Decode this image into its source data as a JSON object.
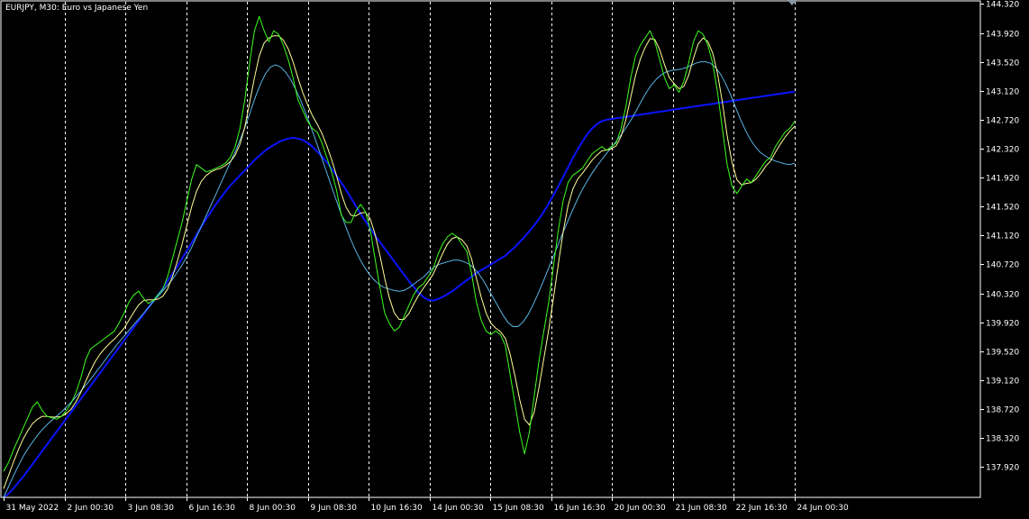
{
  "chart_title": "EURJPY, M30:  Euro vs Japanese Yen",
  "colors": {
    "background": "#000000",
    "frame": "#ffffff",
    "price": "#3cff1e",
    "ma_fast": "#ffff99",
    "ma_mid": "#5ab4e6",
    "ma_slow": "#0a14ff",
    "grid": "#ffffff"
  },
  "chart_data": {
    "type": "line",
    "title": "EURJPY, M30:  Euro vs Japanese Yen",
    "x_labels": [
      "31 May 2022",
      "2 Jun 00:30",
      "3 Jun 08:30",
      "6 Jun 16:30",
      "8 Jun 00:30",
      "9 Jun 08:30",
      "10 Jun 16:30",
      "14 Jun 00:30",
      "15 Jun 08:30",
      "16 Jun 16:30",
      "20 Jun 00:30",
      "21 Jun 08:30",
      "22 Jun 16:30",
      "24 Jun 00:30"
    ],
    "y_ticks": [
      "144.320",
      "143.920",
      "143.520",
      "143.120",
      "142.720",
      "142.320",
      "141.920",
      "141.520",
      "141.120",
      "140.720",
      "140.320",
      "139.920",
      "139.520",
      "139.120",
      "138.720",
      "138.320",
      "137.920"
    ],
    "ylim": [
      137.5,
      144.35
    ],
    "x_count": 14,
    "grid": "vertical dashed",
    "series": [
      {
        "key": "price",
        "color": "#3cff1e",
        "width": 1,
        "values": [
          137.86,
          137.98,
          138.15,
          138.3,
          138.45,
          138.6,
          138.75,
          138.82,
          138.7,
          138.62,
          138.6,
          138.58,
          138.62,
          138.7,
          138.8,
          138.95,
          139.15,
          139.4,
          139.55,
          139.6,
          139.65,
          139.7,
          139.75,
          139.8,
          139.92,
          140.05,
          140.2,
          140.3,
          140.35,
          140.25,
          140.18,
          140.22,
          140.3,
          140.38,
          140.55,
          140.8,
          141.05,
          141.3,
          141.6,
          141.9,
          142.1,
          142.05,
          142.0,
          142.02,
          142.05,
          142.08,
          142.12,
          142.2,
          142.35,
          142.6,
          143.0,
          143.5,
          143.95,
          144.15,
          143.95,
          143.8,
          143.95,
          143.9,
          143.75,
          143.55,
          143.3,
          143.0,
          142.85,
          142.7,
          142.6,
          142.55,
          142.4,
          142.2,
          142.0,
          141.75,
          141.4,
          141.3,
          141.3,
          141.45,
          141.55,
          141.45,
          141.2,
          140.8,
          140.4,
          140.05,
          139.9,
          139.8,
          139.85,
          140.0,
          140.15,
          140.3,
          140.4,
          140.45,
          140.55,
          140.65,
          140.85,
          141.0,
          141.1,
          141.15,
          141.1,
          141.0,
          140.9,
          140.6,
          140.2,
          139.95,
          139.8,
          139.75,
          139.8,
          139.75,
          139.6,
          139.2,
          138.8,
          138.4,
          138.1,
          138.4,
          138.9,
          139.4,
          139.8,
          140.2,
          140.7,
          141.2,
          141.6,
          141.85,
          141.95,
          142.0,
          142.05,
          142.15,
          142.25,
          142.3,
          142.35,
          142.3,
          142.35,
          142.4,
          142.6,
          142.9,
          143.3,
          143.6,
          143.75,
          143.85,
          143.95,
          143.8,
          143.55,
          143.3,
          143.15,
          143.2,
          143.1,
          143.25,
          143.5,
          143.8,
          143.95,
          143.9,
          143.75,
          143.5,
          143.1,
          142.6,
          142.1,
          141.8,
          141.7,
          141.8,
          141.9,
          141.85,
          141.95,
          142.05,
          142.15,
          142.2,
          142.35,
          142.45,
          142.55,
          142.6,
          142.7
        ]
      },
      {
        "key": "ma_fast",
        "color": "#ffff99",
        "width": 1,
        "values": [
          137.62,
          137.8,
          137.98,
          138.15,
          138.3,
          138.42,
          138.52,
          138.58,
          138.62,
          138.62,
          138.61,
          138.61,
          138.62,
          138.66,
          138.72,
          138.82,
          138.95,
          139.1,
          139.25,
          139.38,
          139.48,
          139.56,
          139.63,
          139.69,
          139.76,
          139.84,
          139.95,
          140.06,
          140.16,
          140.22,
          140.23,
          140.23,
          140.24,
          140.28,
          140.38,
          140.55,
          140.76,
          141.0,
          141.26,
          141.52,
          141.73,
          141.87,
          141.95,
          142.0,
          142.03,
          142.05,
          142.09,
          142.14,
          142.23,
          142.38,
          142.62,
          142.95,
          143.3,
          143.6,
          143.78,
          143.85,
          143.88,
          143.88,
          143.82,
          143.7,
          143.52,
          143.3,
          143.1,
          142.93,
          142.78,
          142.66,
          142.53,
          142.36,
          142.17,
          141.95,
          141.7,
          141.51,
          141.4,
          141.39,
          141.43,
          141.44,
          141.35,
          141.14,
          140.85,
          140.53,
          140.25,
          140.05,
          139.96,
          139.96,
          140.04,
          140.17,
          140.29,
          140.39,
          140.48,
          140.58,
          140.72,
          140.87,
          141.0,
          141.08,
          141.1,
          141.06,
          140.98,
          140.8,
          140.53,
          140.27,
          140.05,
          139.91,
          139.84,
          139.79,
          139.7,
          139.48,
          139.18,
          138.85,
          138.58,
          138.5,
          138.68,
          139.03,
          139.42,
          139.82,
          140.26,
          140.73,
          141.17,
          141.53,
          141.76,
          141.9,
          141.98,
          142.07,
          142.16,
          142.23,
          142.29,
          142.3,
          142.32,
          142.36,
          142.49,
          142.72,
          143.03,
          143.33,
          143.56,
          143.72,
          143.84,
          143.83,
          143.69,
          143.48,
          143.3,
          143.22,
          143.15,
          143.18,
          143.33,
          143.57,
          143.77,
          143.85,
          143.8,
          143.64,
          143.36,
          142.96,
          142.5,
          142.13,
          141.89,
          141.82,
          141.84,
          141.85,
          141.9,
          141.98,
          142.08,
          142.15,
          142.27,
          142.38,
          142.48,
          142.56,
          142.63
        ]
      },
      {
        "key": "ma_mid",
        "color": "#5ab4e6",
        "width": 1,
        "values": [
          137.5,
          137.65,
          137.8,
          137.94,
          138.07,
          138.18,
          138.28,
          138.37,
          138.45,
          138.52,
          138.58,
          138.64,
          138.7,
          138.77,
          138.84,
          138.92,
          139.0,
          139.08,
          139.17,
          139.26,
          139.35,
          139.44,
          139.53,
          139.62,
          139.7,
          139.78,
          139.86,
          139.94,
          140.02,
          140.1,
          140.18,
          140.26,
          140.34,
          140.42,
          140.5,
          140.6,
          140.7,
          140.82,
          140.95,
          141.1,
          141.25,
          141.4,
          141.55,
          141.7,
          141.85,
          142.0,
          142.15,
          142.3,
          142.47,
          142.65,
          142.85,
          143.05,
          143.22,
          143.36,
          143.45,
          143.48,
          143.45,
          143.38,
          143.28,
          143.15,
          143.0,
          142.83,
          142.65,
          142.46,
          142.26,
          142.06,
          141.86,
          141.66,
          141.47,
          141.28,
          141.1,
          140.94,
          140.8,
          140.68,
          140.58,
          140.5,
          140.44,
          140.4,
          140.38,
          140.36,
          140.35,
          140.36,
          140.4,
          140.45,
          140.5,
          140.55,
          140.62,
          140.68,
          140.72,
          140.74,
          140.76,
          140.78,
          140.78,
          140.76,
          140.73,
          140.68,
          140.6,
          140.5,
          140.38,
          140.26,
          140.14,
          140.02,
          139.92,
          139.86,
          139.86,
          139.92,
          140.02,
          140.15,
          140.3,
          140.46,
          140.63,
          140.8,
          140.97,
          141.14,
          141.3,
          141.46,
          141.61,
          141.75,
          141.87,
          141.98,
          142.08,
          142.17,
          142.26,
          142.34,
          142.43,
          142.52,
          142.62,
          142.73,
          142.85,
          142.98,
          143.1,
          143.2,
          143.28,
          143.34,
          143.38,
          143.4,
          143.41,
          143.42,
          143.44,
          143.47,
          143.5,
          143.52,
          143.52,
          143.5,
          143.44,
          143.35,
          143.22,
          143.07,
          142.9,
          142.73,
          142.58,
          142.45,
          142.35,
          142.27,
          142.22,
          142.18,
          142.15,
          142.13,
          142.11,
          142.1,
          142.12
        ]
      },
      {
        "key": "ma_slow",
        "color": "#0a14ff",
        "width": 2,
        "values": [
          137.5,
          137.55,
          137.62,
          137.7,
          137.78,
          137.87,
          137.96,
          138.05,
          138.14,
          138.23,
          138.32,
          138.41,
          138.5,
          138.59,
          138.68,
          138.77,
          138.86,
          138.95,
          139.04,
          139.13,
          139.22,
          139.31,
          139.4,
          139.49,
          139.58,
          139.67,
          139.76,
          139.85,
          139.94,
          140.03,
          140.12,
          140.21,
          140.3,
          140.39,
          140.49,
          140.59,
          140.69,
          140.8,
          140.91,
          141.02,
          141.13,
          141.24,
          141.35,
          141.45,
          141.55,
          141.64,
          141.73,
          141.81,
          141.88,
          141.95,
          142.02,
          142.09,
          142.16,
          142.22,
          142.28,
          142.33,
          142.37,
          142.41,
          142.44,
          142.46,
          142.47,
          142.46,
          142.44,
          142.4,
          142.35,
          142.28,
          142.21,
          142.13,
          142.04,
          141.95,
          141.85,
          141.75,
          141.64,
          141.53,
          141.42,
          141.32,
          141.22,
          141.12,
          141.03,
          140.94,
          140.85,
          140.76,
          140.67,
          140.58,
          140.49,
          140.41,
          140.33,
          140.27,
          140.23,
          140.22,
          140.24,
          140.27,
          140.31,
          140.35,
          140.4,
          140.45,
          140.5,
          140.55,
          140.6,
          140.64,
          140.68,
          140.72,
          140.76,
          140.8,
          140.84,
          140.9,
          140.96,
          141.03,
          141.1,
          141.18,
          141.26,
          141.35,
          141.45,
          141.56,
          141.68,
          141.8,
          141.93,
          142.06,
          142.19,
          142.31,
          142.42,
          142.52,
          142.6,
          142.66,
          142.7,
          142.72,
          142.73,
          142.74,
          142.75,
          142.76,
          142.77,
          142.78,
          142.79,
          142.8,
          142.81,
          142.82,
          142.83,
          142.84,
          142.85,
          142.86,
          142.87,
          142.88,
          142.89,
          142.9,
          142.91,
          142.92,
          142.93,
          142.94,
          142.95,
          142.96,
          142.97,
          142.98,
          142.99,
          143.0,
          143.01,
          143.02,
          143.03,
          143.04,
          143.05,
          143.06,
          143.07,
          143.08,
          143.09,
          143.1,
          143.11
        ]
      }
    ]
  }
}
